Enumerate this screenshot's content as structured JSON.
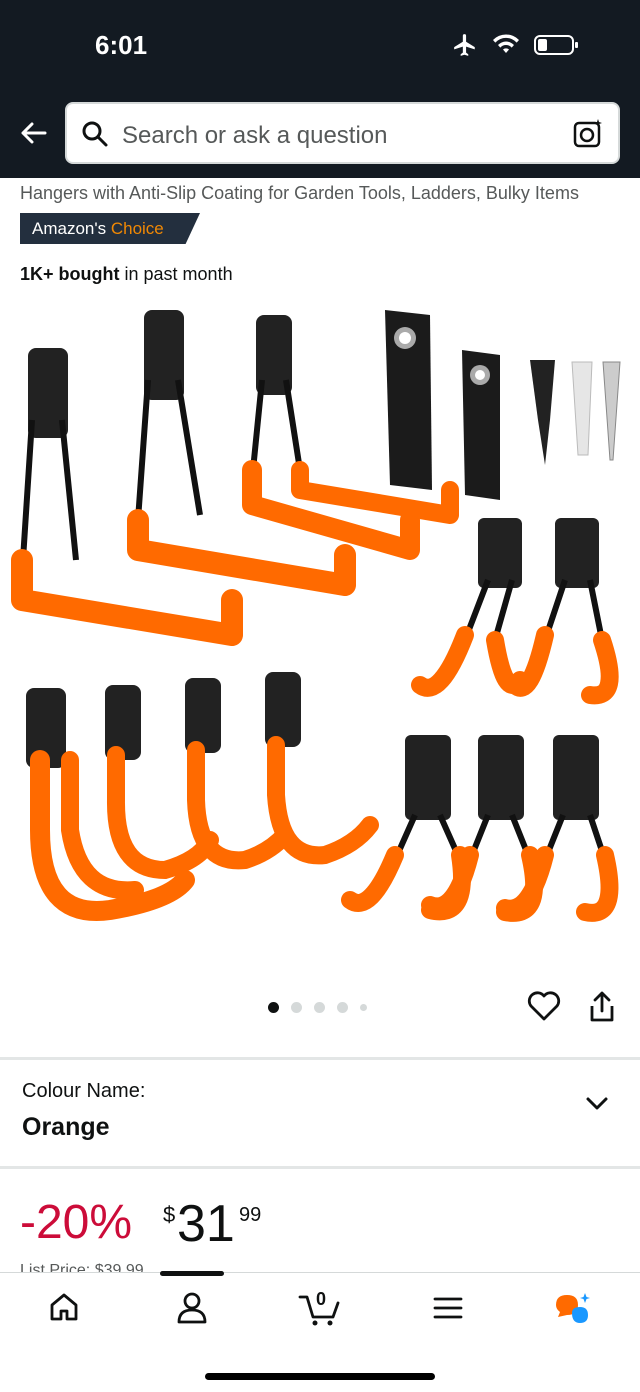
{
  "status": {
    "time": "6:01"
  },
  "search": {
    "placeholder": "Search or ask a question"
  },
  "product": {
    "title_tail": "Hangers with Anti-Slip Coating for Garden Tools, Ladders, Bulky Items",
    "badge_prefix": "Amazon's",
    "badge_suffix": "Choice",
    "bought_bold": "1K+ bought",
    "bought_rest": "in past month",
    "image_count": 5,
    "image_active": 1
  },
  "colour": {
    "label": "Colour Name:",
    "value": "Orange"
  },
  "price": {
    "discount": "-20%",
    "symbol": "$",
    "whole": "31",
    "fraction": "99",
    "list_price_partial": "List Price: $39.99"
  },
  "nav": {
    "cart_count": "0"
  },
  "colors": {
    "accent": "#ff6a00",
    "header": "#131a22",
    "discount": "#cc0c39",
    "choice": "#f08804"
  }
}
